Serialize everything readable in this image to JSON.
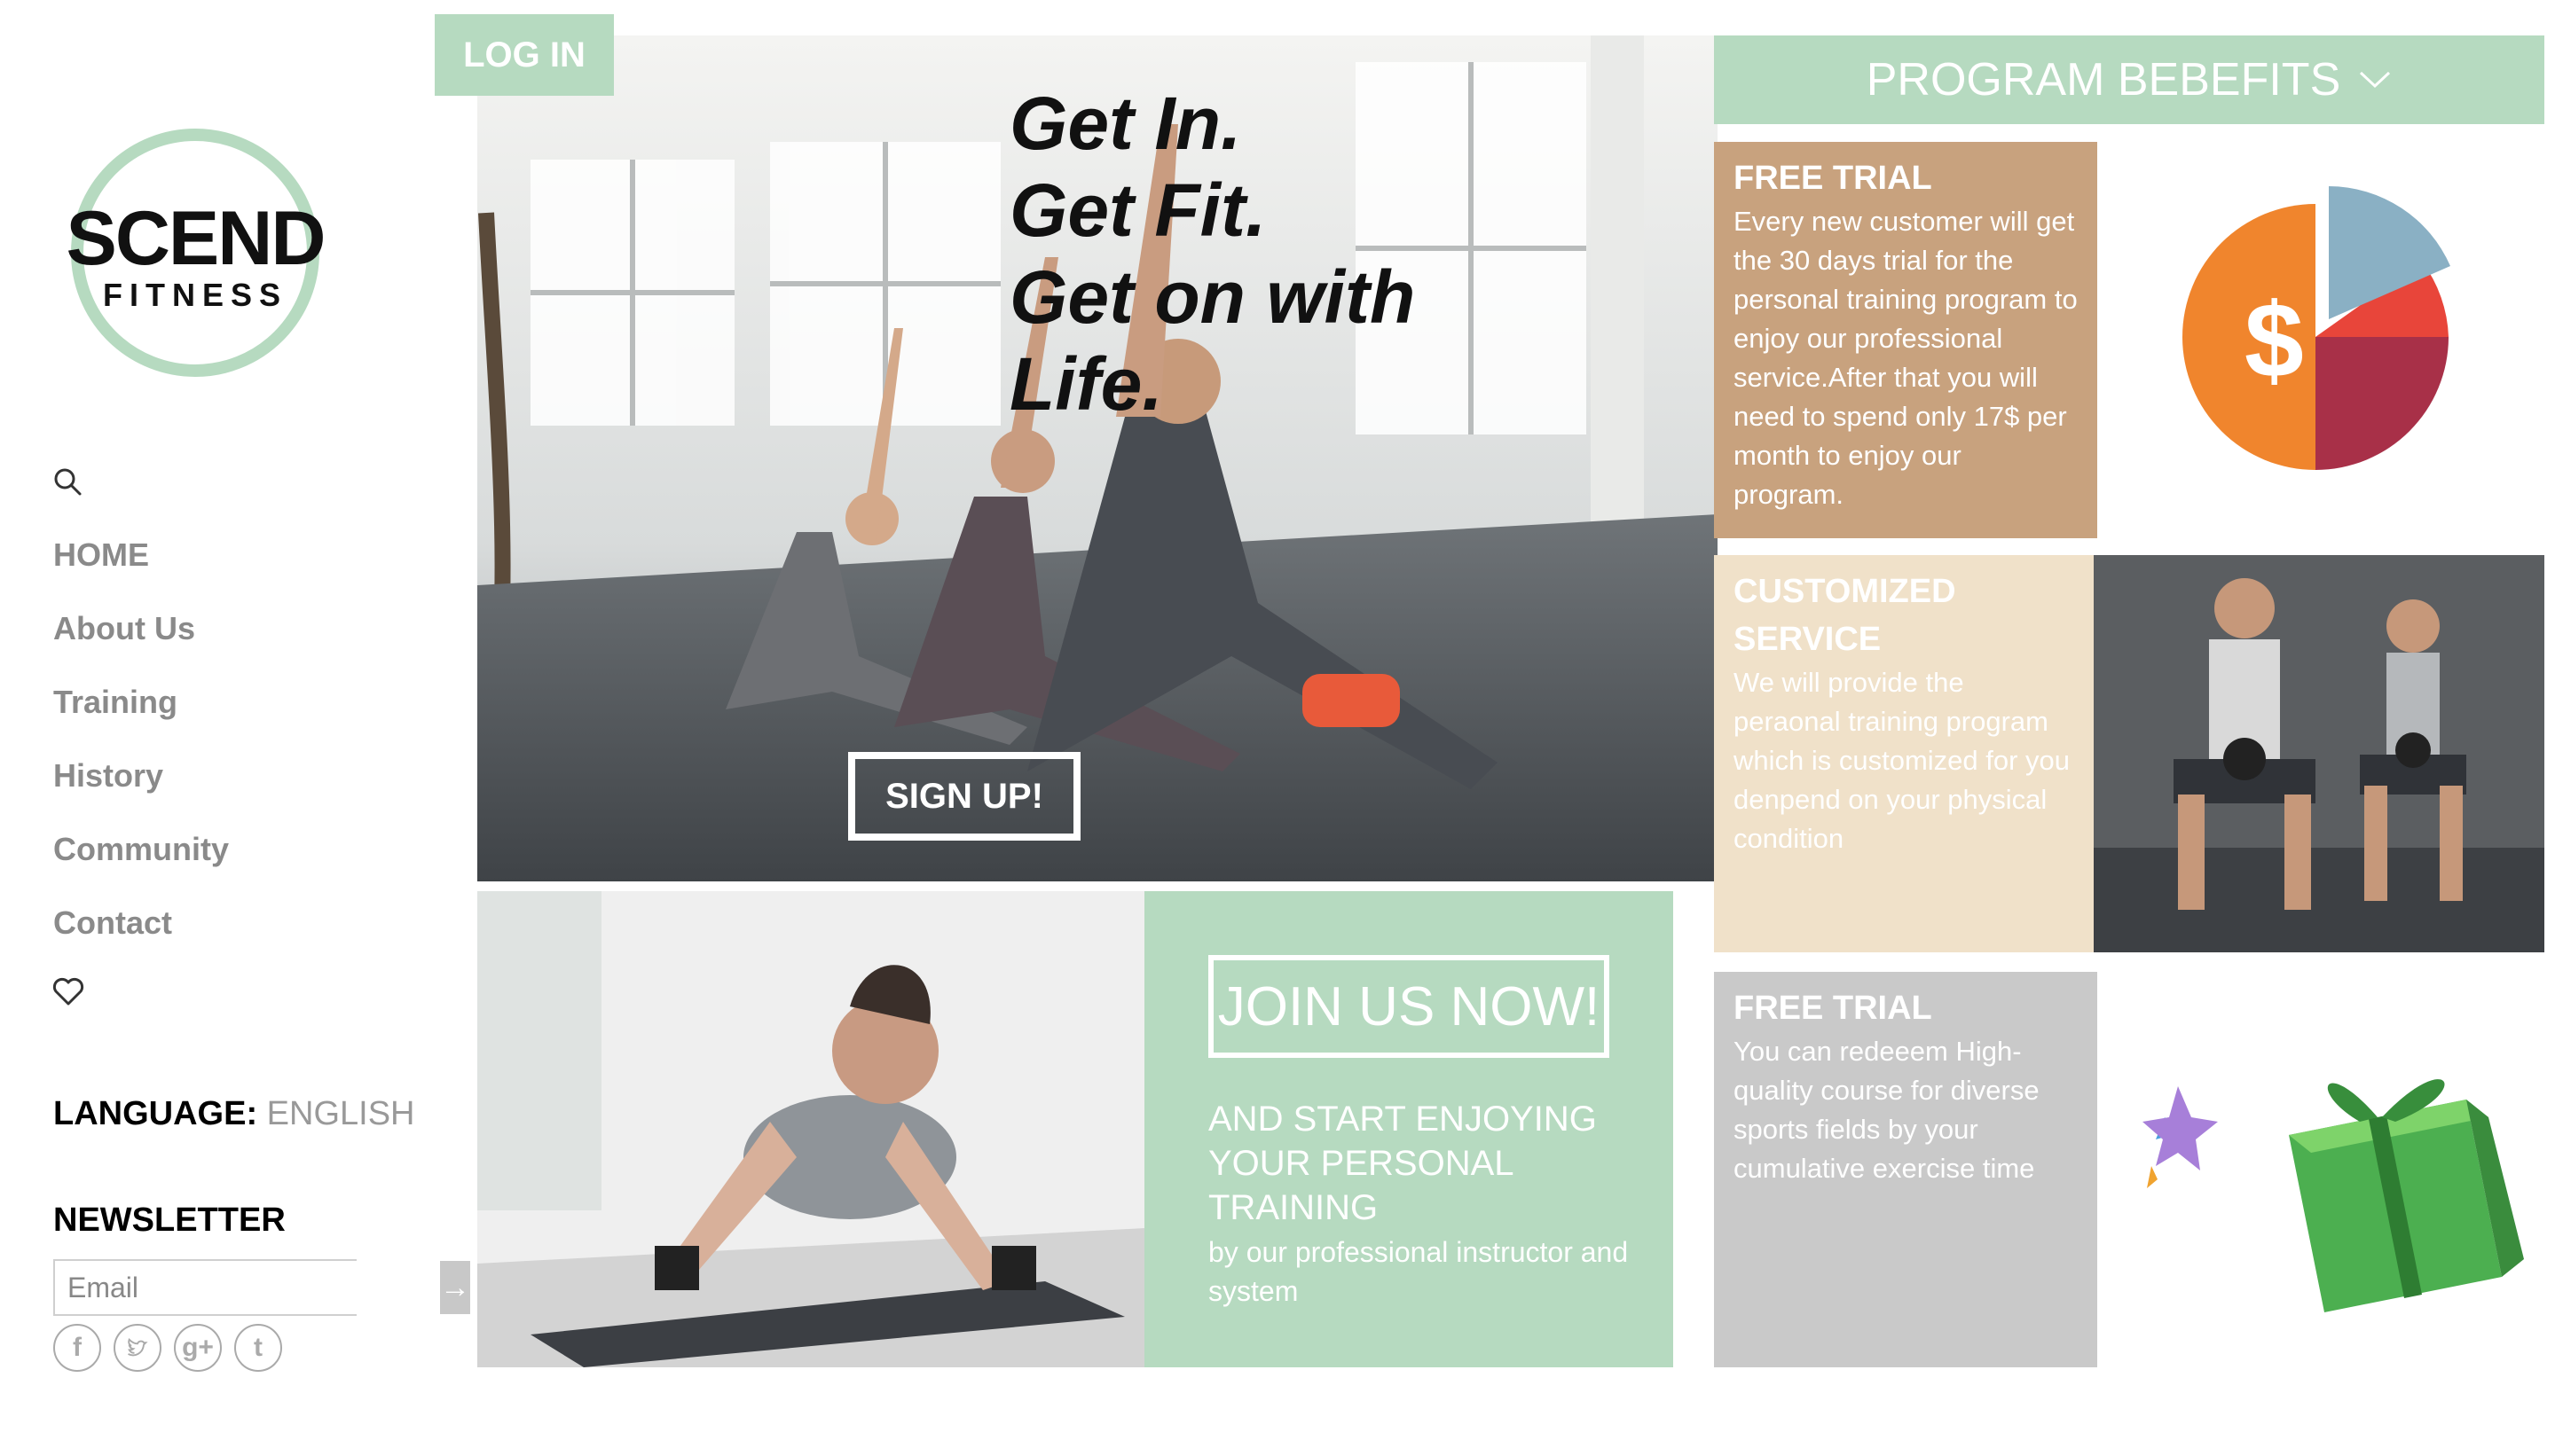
{
  "brand": {
    "name": "SCEND",
    "sub": "FITNESS"
  },
  "header": {
    "login_label": "LOG IN"
  },
  "nav": {
    "items": [
      "HOME",
      "About Us",
      "Training",
      "History",
      "Community",
      "Contact"
    ]
  },
  "icons": {
    "search": "search-icon",
    "heart": "heart-icon",
    "submit": "arrow-right-icon",
    "chevron": "chevron-down-icon"
  },
  "language": {
    "label": "LANGUAGE:",
    "value": "ENGLISH"
  },
  "newsletter": {
    "title": "NEWSLETTER",
    "placeholder": "Email",
    "submit_symbol": "→"
  },
  "social": {
    "items": [
      "facebook-icon",
      "twitter-icon",
      "google-plus-icon",
      "tumblr-icon"
    ]
  },
  "hero": {
    "lines": [
      "Get In.",
      "Get Fit.",
      "Get on with",
      "Life."
    ],
    "signup_label": "SIGN UP!"
  },
  "join": {
    "button_label": "JOIN US NOW!",
    "headline": "AND START ENJOYING YOUR PERSONAL TRAINING",
    "sub": "by our professional instructor and system"
  },
  "benefits": {
    "header": "PROGRAM BEBEFITS",
    "cards": [
      {
        "title": "FREE TRIAL",
        "body": "Every new customer will get the 30 days trial for the personal training program to enjoy our professional service.After that you will need to spend only 17$ per month to enjoy our program."
      },
      {
        "title": "CUSTOMIZED SERVICE",
        "body": "We will provide the peraonal training program which is customized for you denpend on your physical condition"
      },
      {
        "title": "FREE TRIAL",
        "body": "You can redeeem High-quality course for diverse sports fields by your cumulative exercise time"
      }
    ]
  },
  "colors": {
    "mint": "#b6dac0",
    "tan": "#c8a27e",
    "cream": "#f0e1c9",
    "grey": "#c9c9c9",
    "orange": "#f0852d",
    "red": "#e8453a",
    "maroon": "#a83048",
    "steel": "#8ab0c4"
  }
}
